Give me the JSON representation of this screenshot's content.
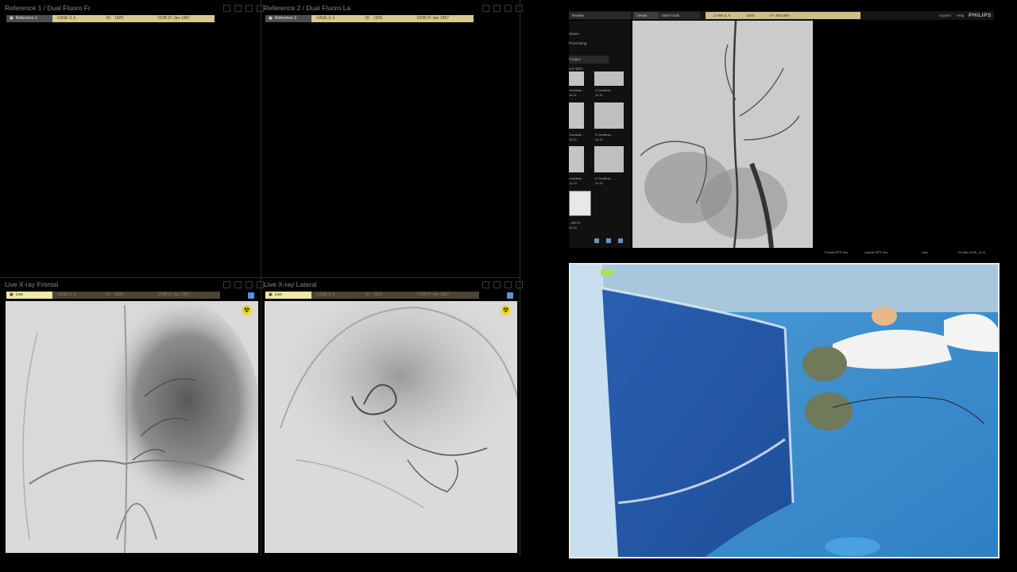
{
  "panes": {
    "ref1": {
      "title": "Reference 1 / Dual Fluoro Fr",
      "source": "Reference 1",
      "case": "CASE-3, k",
      "id_label": "ID",
      "id": "1929",
      "dob_label": "DOB",
      "dob": "07-Jan-1967"
    },
    "ref2": {
      "title": "Reference 2 / Dual Fluoro La",
      "source": "Reference 2",
      "case": "CASE-3, k",
      "id_label": "ID",
      "id": "1929",
      "dob_label": "DOB",
      "dob": "07-Jan-1967"
    },
    "live_frontal": {
      "title": "Live X-ray Frontal",
      "source": "Live",
      "case": "CASE-3, k",
      "id_label": "ID",
      "id": "1929",
      "dob_label": "DOB",
      "dob": "07-Jan-1967"
    },
    "live_lateral": {
      "title": "Live X-ray Lateral",
      "source": "Live",
      "case": "CASE-3, k",
      "id_label": "ID",
      "id": "1929",
      "dob_label": "DOB",
      "dob": "07-Jan-1967"
    }
  },
  "icons": {
    "radiation": "radiation-warning-icon",
    "copy": "copy-icon",
    "monitor": "monitor-icon"
  },
  "colors": {
    "live_tag": "#f1e9a6",
    "case_tag": "#d9c98c",
    "radiation": "#f1d92a",
    "drape": "#5aa5dc"
  },
  "workstation": {
    "tabs": [
      "Review",
      "Viewer",
      "More Tools"
    ],
    "case": "CASE-3, k",
    "id": "1929",
    "dob": "07-Jan-1967",
    "system": "System",
    "help": "Help",
    "brand": "PHILIPS",
    "sidebar": {
      "rows": [
        "Series",
        "Processing",
        "Images"
      ],
      "group_label": "Cer DSA",
      "thumbs": [
        {
          "left": "Cerebral...",
          "left_time": "11:11",
          "right": "4 Cerebral...",
          "right_time": "11:11"
        },
        {
          "left": "Cerebral...",
          "left_time": "11:12",
          "right": "5 Cerebral...",
          "right_time": "11:12"
        },
        {
          "left": "Cerebral...",
          "left_time": "11:13",
          "right": "6 Cerebral...",
          "right_time": "11:13"
        }
      ],
      "last_label": "...RR Pt",
      "last_time": "11:19"
    },
    "status": {
      "frontal": "Frontal RFS free",
      "lateral": "Lateral RFS free",
      "user": "User",
      "datetime": "04-Mar-2026, 11:41"
    }
  }
}
